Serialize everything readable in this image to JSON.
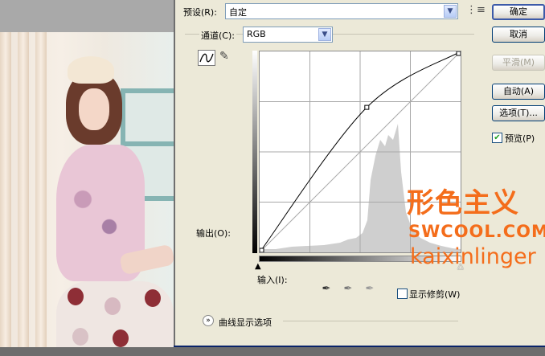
{
  "dialog": {
    "preset_label": "预设(R):",
    "preset_value": "自定",
    "channel_label": "通道(C):",
    "channel_value": "RGB",
    "output_label": "输出(O):",
    "input_label": "输入(I):",
    "show_clipping_label": "显示修剪(W)",
    "curve_options_label": "曲线显示选项"
  },
  "buttons": {
    "ok": "确定",
    "cancel": "取消",
    "smooth": "平滑(M)",
    "auto": "自动(A)",
    "options": "选项(T)..."
  },
  "preview": {
    "label": "预览(P)",
    "checked": true
  },
  "watermark": {
    "logo": "形色主义",
    "site": "SWCOOL.COM",
    "author": "kaixinlinger"
  },
  "curve": {
    "points": [
      [
        0,
        0
      ],
      [
        136,
        184
      ],
      [
        255,
        255
      ]
    ]
  },
  "icons": {
    "preset_menu": "preset-menu-icon",
    "curve_tool": "curve-tool-icon",
    "pencil_tool": "pencil-icon",
    "expand": "expand-chevron-icon"
  }
}
